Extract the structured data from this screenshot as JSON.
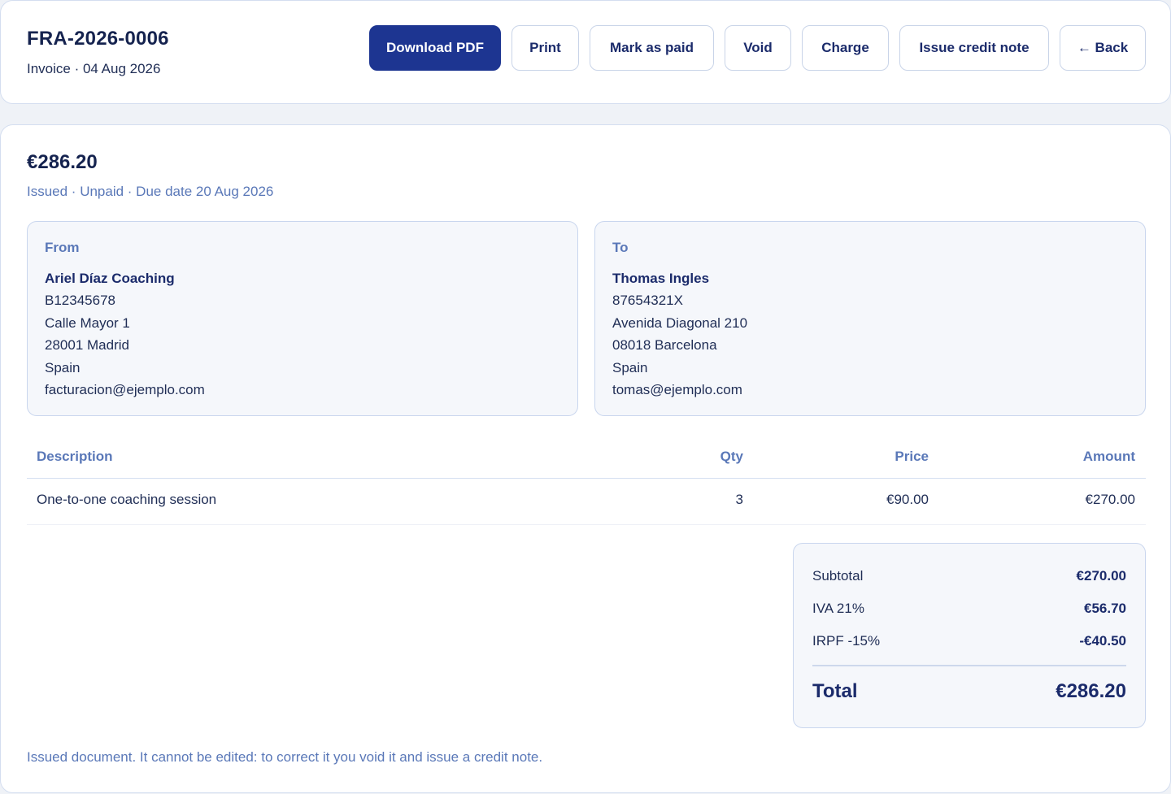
{
  "header": {
    "invoice_number": "FRA-2026-0006",
    "meta": "Invoice · 04 Aug 2026",
    "actions": {
      "download_pdf": "Download PDF",
      "print": "Print",
      "mark_as_paid": "Mark as paid",
      "void": "Void",
      "charge": "Charge",
      "issue_credit_note": "Issue credit note",
      "back": "← Back"
    }
  },
  "summary": {
    "amount": "€286.20",
    "status_line": "Issued · Unpaid · Due date 20 Aug 2026"
  },
  "from": {
    "label": "From",
    "name": "Ariel Díaz Coaching",
    "tax_id": "B12345678",
    "address": "Calle Mayor 1",
    "city": "28001 Madrid",
    "country": "Spain",
    "email": "facturacion@ejemplo.com"
  },
  "to": {
    "label": "To",
    "name": "Thomas Ingles",
    "tax_id": "87654321X",
    "address": "Avenida Diagonal 210",
    "city": "08018 Barcelona",
    "country": "Spain",
    "email": "tomas@ejemplo.com"
  },
  "items": {
    "columns": {
      "description": "Description",
      "qty": "Qty",
      "price": "Price",
      "amount": "Amount"
    },
    "rows": [
      {
        "description": "One-to-one coaching session",
        "qty": "3",
        "price": "€90.00",
        "amount": "€270.00"
      }
    ]
  },
  "totals": {
    "subtotal_label": "Subtotal",
    "subtotal_value": "€270.00",
    "iva_label": "IVA 21%",
    "iva_value": "€56.70",
    "irpf_label": "IRPF -15%",
    "irpf_value": "-€40.50",
    "total_label": "Total",
    "total_value": "€286.20"
  },
  "footer_note": "Issued document. It cannot be edited: to correct it you void it and issue a credit note.",
  "colors": {
    "primary": "#1d3591",
    "accent_text": "#5a78b8",
    "heading_text": "#15234f"
  }
}
